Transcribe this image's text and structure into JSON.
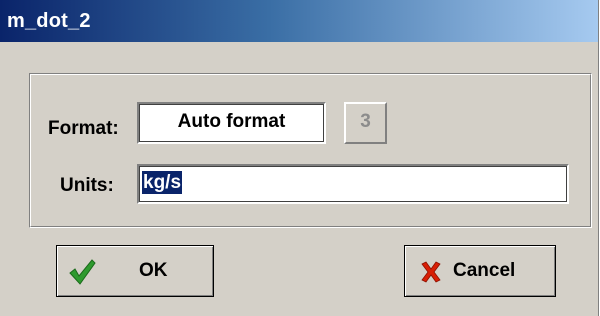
{
  "window": {
    "title": "m_dot_2"
  },
  "format": {
    "label": "Format:",
    "selected_value": "Auto format",
    "digits_value": "3"
  },
  "units": {
    "label": "Units:",
    "value": "kg/s"
  },
  "buttons": {
    "ok_label": "OK",
    "cancel_label": "Cancel",
    "ok_icon": "checkmark-icon",
    "cancel_icon": "x-icon"
  },
  "colors": {
    "titlebar_start": "#0a246a",
    "titlebar_end": "#a6caf0",
    "dialog_face": "#d4d0c8",
    "ok_check": "#2e9a2e",
    "cancel_x": "#d81e05",
    "selection": "#0a246a"
  }
}
